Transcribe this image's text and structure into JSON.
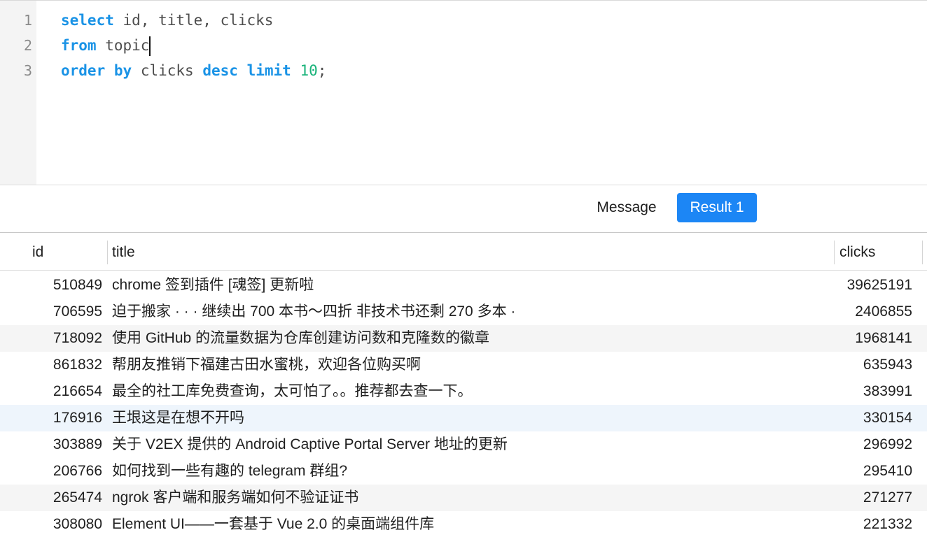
{
  "editor": {
    "line_numbers": [
      "1",
      "2",
      "3"
    ],
    "line1": {
      "kw1": "select",
      "rest": " id, title, clicks"
    },
    "line2": {
      "kw1": "from",
      "rest": " topic"
    },
    "line3": {
      "kw1": "order",
      "sp1": " ",
      "kw2": "by",
      "mid": " clicks ",
      "kw3": "desc",
      "sp2": " ",
      "kw4": "limit",
      "sp3": " ",
      "num": "10",
      "end": ";"
    }
  },
  "tabs": {
    "message": "Message",
    "result": "Result 1"
  },
  "grid": {
    "columns": [
      "id",
      "title",
      "clicks"
    ],
    "rows": [
      {
        "id": "510849",
        "title": "chrome 签到插件 [魂签] 更新啦",
        "clicks": "39625191"
      },
      {
        "id": "706595",
        "title": "迫于搬家 · · · 继续出 700 本书～四折 非技术书还剩 270 多本 ·",
        "clicks": "2406855"
      },
      {
        "id": "718092",
        "title": "使用 GitHub 的流量数据为仓库创建访问数和克隆数的徽章",
        "clicks": "1968141"
      },
      {
        "id": "861832",
        "title": "帮朋友推销下福建古田水蜜桃，欢迎各位购买啊",
        "clicks": "635943"
      },
      {
        "id": "216654",
        "title": "最全的社工库免费查询，太可怕了。。推荐都去查一下。",
        "clicks": "383991"
      },
      {
        "id": "176916",
        "title": "王垠这是在想不开吗",
        "clicks": "330154"
      },
      {
        "id": "303889",
        "title": "关于 V2EX 提供的 Android Captive Portal Server 地址的更新",
        "clicks": "296992"
      },
      {
        "id": "206766",
        "title": "如何找到一些有趣的 telegram 群组?",
        "clicks": "295410"
      },
      {
        "id": "265474",
        "title": "ngrok 客户端和服务端如何不验证证书",
        "clicks": "271277"
      },
      {
        "id": "308080",
        "title": "Element UI——一套基于 Vue 2.0 的桌面端组件库",
        "clicks": "221332"
      }
    ]
  },
  "colors": {
    "keyword": "#1a93e6",
    "number": "#19b37a",
    "accent": "#1c86f5",
    "row_alt": "#f5f5f5",
    "row_hover": "#eef5fc"
  }
}
